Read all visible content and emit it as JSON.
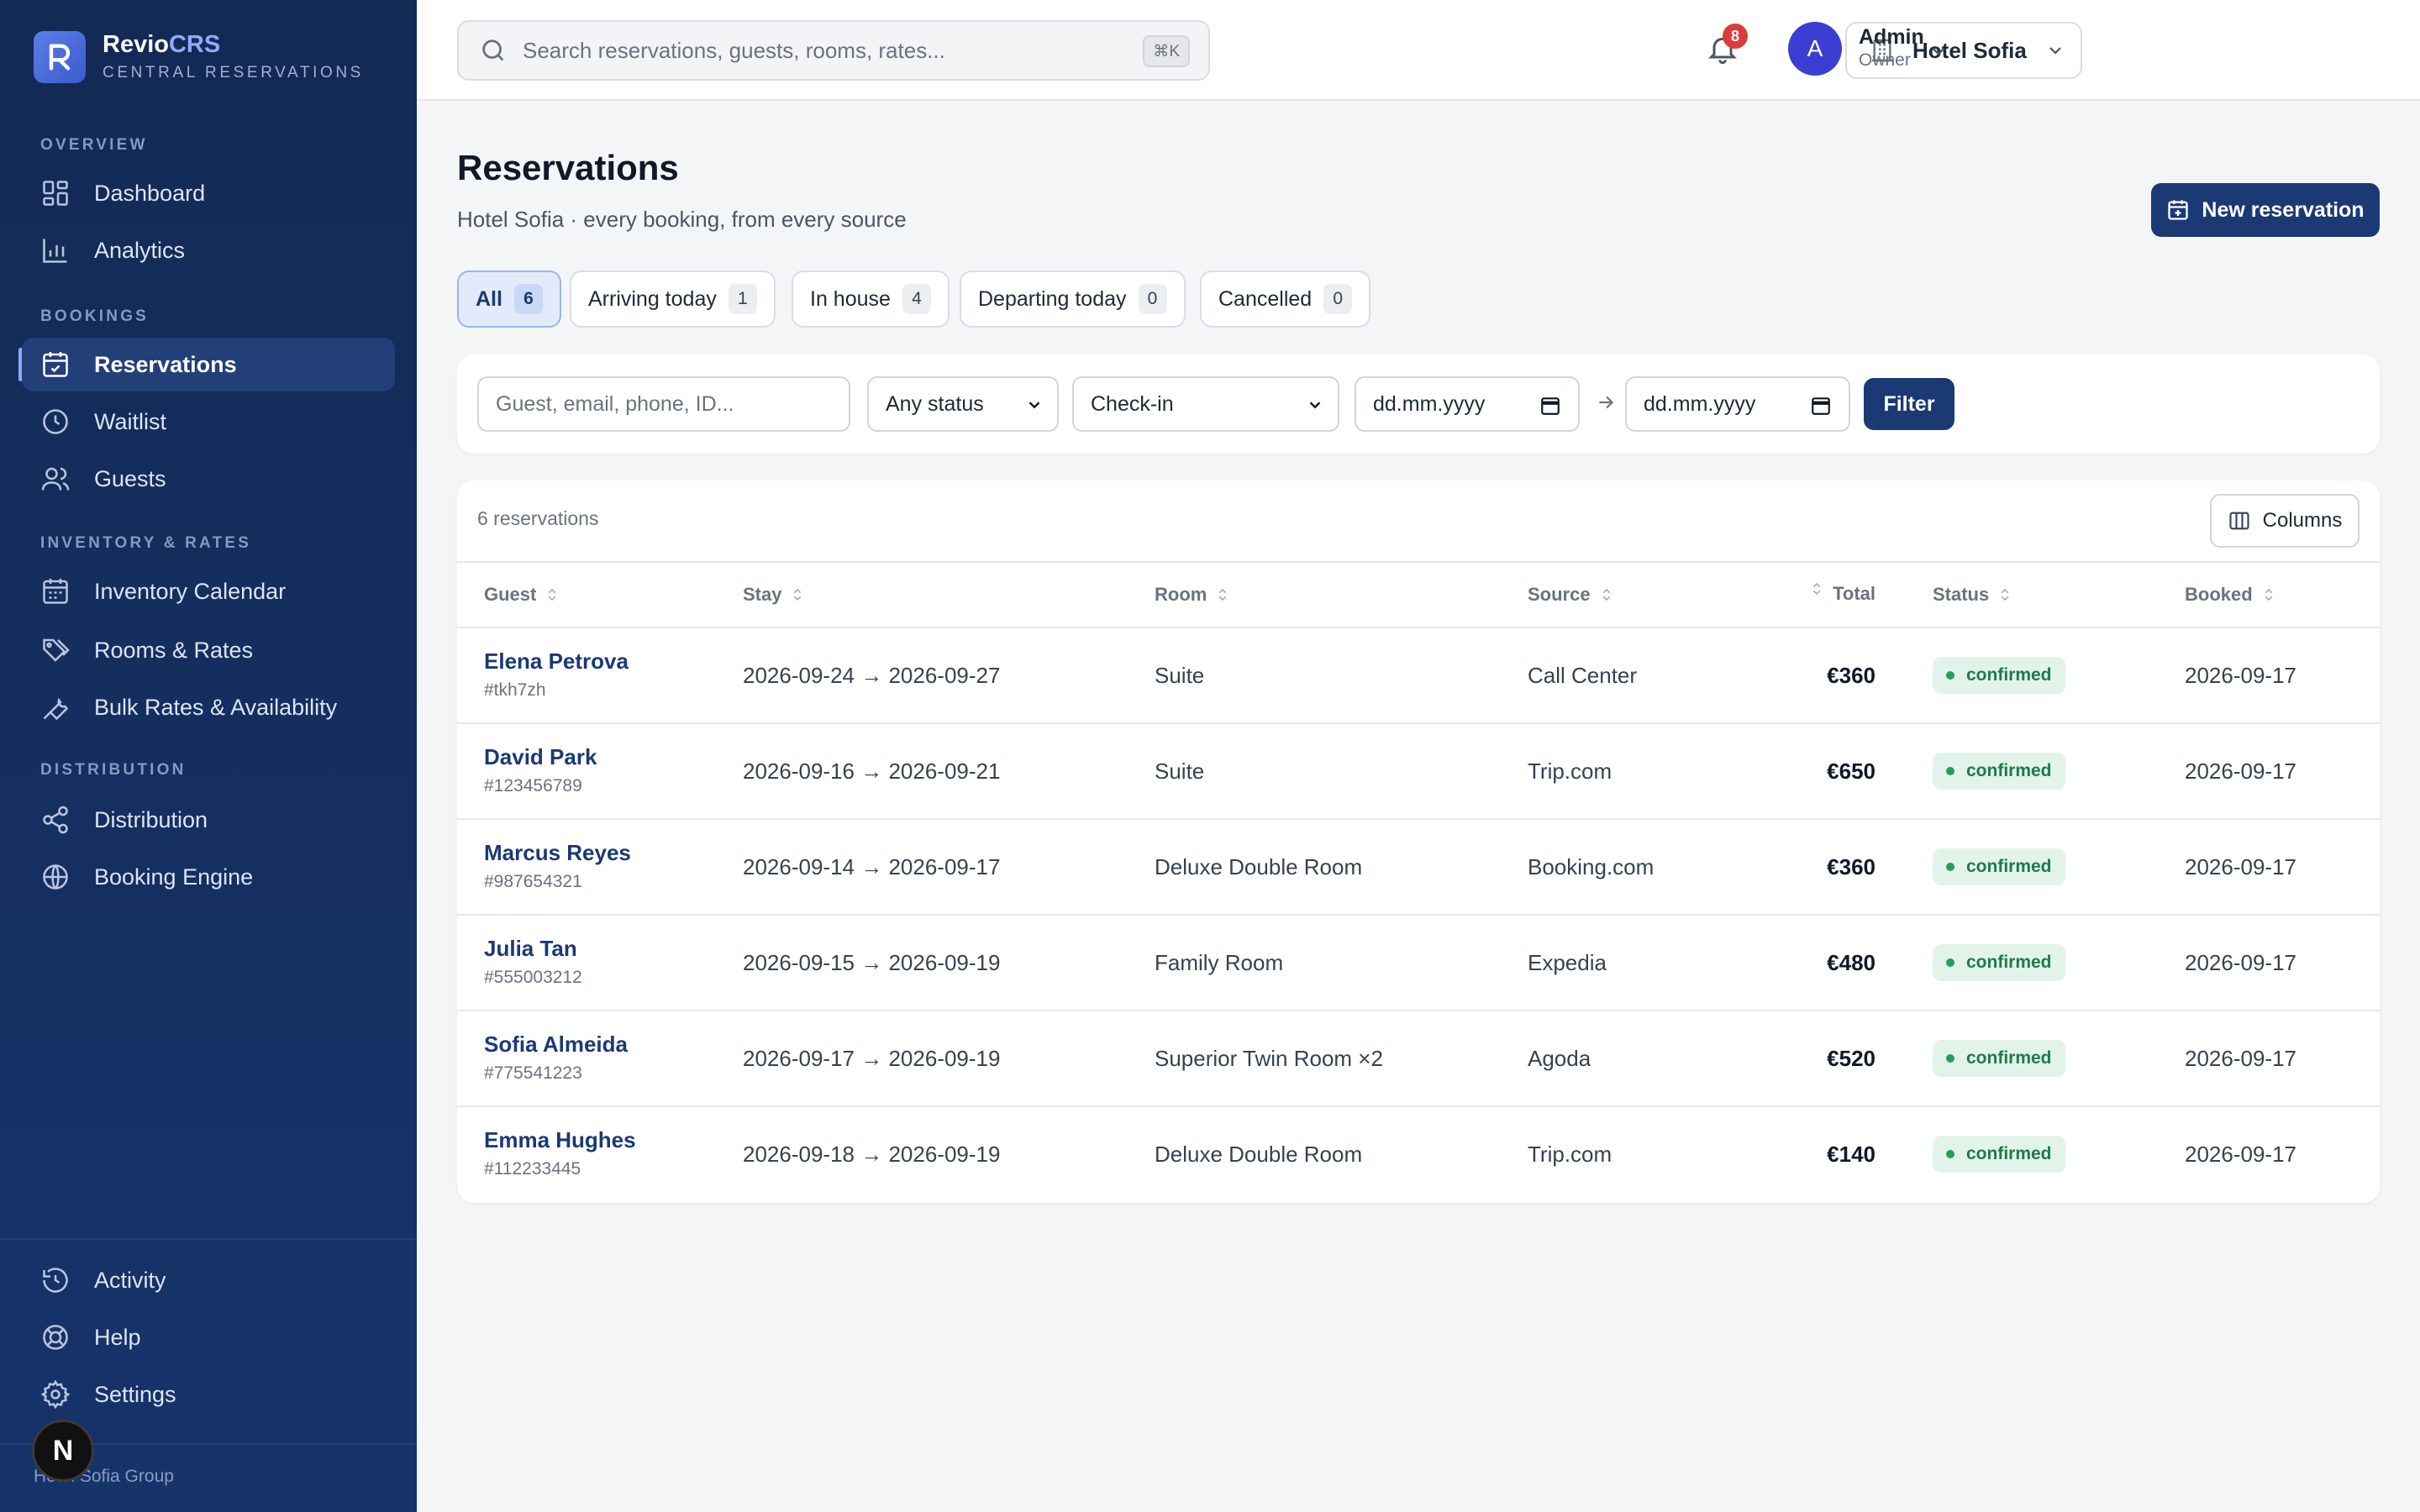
{
  "brand": {
    "name_main": "Revio",
    "name_accent": "CRS",
    "subtitle": "CENTRAL RESERVATIONS"
  },
  "sidebar": {
    "sections": [
      {
        "title": "OVERVIEW"
      },
      {
        "title": "BOOKINGS"
      },
      {
        "title": "INVENTORY & RATES"
      },
      {
        "title": "DISTRIBUTION"
      }
    ],
    "items": [
      {
        "label": "Dashboard",
        "icon": "dashboard-icon"
      },
      {
        "label": "Analytics",
        "icon": "analytics-icon"
      },
      {
        "label": "Reservations",
        "icon": "calendar-check-icon",
        "active": true
      },
      {
        "label": "Waitlist",
        "icon": "clock-icon"
      },
      {
        "label": "Guests",
        "icon": "users-icon"
      },
      {
        "label": "Inventory Calendar",
        "icon": "calendar-icon"
      },
      {
        "label": "Rooms & Rates",
        "icon": "tags-icon"
      },
      {
        "label": "Bulk Rates & Availability",
        "icon": "wrench-icon"
      },
      {
        "label": "Distribution",
        "icon": "share-icon"
      },
      {
        "label": "Booking Engine",
        "icon": "globe-icon"
      }
    ],
    "bottom_items": [
      {
        "label": "Activity",
        "icon": "history-icon"
      },
      {
        "label": "Help",
        "icon": "lifebuoy-icon"
      },
      {
        "label": "Settings",
        "icon": "gear-icon"
      }
    ],
    "footer": "Hotel Sofia Group",
    "badge_letter": "N"
  },
  "topbar": {
    "search_placeholder": "Search reservations, guests, rooms, rates...",
    "search_shortcut": "⌘K",
    "hotel": "Hotel Sofia",
    "notifications": "8",
    "user": {
      "initial": "A",
      "name": "Admin",
      "role": "Owner"
    }
  },
  "page": {
    "title": "Reservations",
    "subtitle": "Hotel Sofia · every booking, from every source",
    "new_button": "New reservation"
  },
  "tabs": [
    {
      "label": "All",
      "count": "6",
      "active": true
    },
    {
      "label": "Arriving today",
      "count": "1"
    },
    {
      "label": "In house",
      "count": "4"
    },
    {
      "label": "Departing today",
      "count": "0"
    },
    {
      "label": "Cancelled",
      "count": "0"
    }
  ],
  "filters": {
    "query_placeholder": "Guest, email, phone, ID...",
    "status_value": "Any status",
    "date_field_value": "Check-in",
    "date_from_placeholder": "dd.mm.yyyy",
    "date_to_placeholder": "dd.mm.yyyy",
    "filter_button": "Filter"
  },
  "table": {
    "count_label": "6 reservations",
    "columns_button": "Columns",
    "headers": {
      "guest": "Guest",
      "stay": "Stay",
      "room": "Room",
      "source": "Source",
      "total": "Total",
      "status": "Status",
      "booked": "Booked"
    },
    "rows": [
      {
        "name": "Elena Petrova",
        "id": "#tkh7zh",
        "stay": "2026-09-24 → 2026-09-27",
        "room": "Suite",
        "source": "Call Center",
        "total": "€360",
        "status": "confirmed",
        "booked": "2026-09-17"
      },
      {
        "name": "David Park",
        "id": "#123456789",
        "stay": "2026-09-16 → 2026-09-21",
        "room": "Suite",
        "source": "Trip.com",
        "total": "€650",
        "status": "confirmed",
        "booked": "2026-09-17"
      },
      {
        "name": "Marcus Reyes",
        "id": "#987654321",
        "stay": "2026-09-14 → 2026-09-17",
        "room": "Deluxe Double Room",
        "source": "Booking.com",
        "total": "€360",
        "status": "confirmed",
        "booked": "2026-09-17"
      },
      {
        "name": "Julia Tan",
        "id": "#555003212",
        "stay": "2026-09-15 → 2026-09-19",
        "room": "Family Room",
        "source": "Expedia",
        "total": "€480",
        "status": "confirmed",
        "booked": "2026-09-17"
      },
      {
        "name": "Sofia Almeida",
        "id": "#775541223",
        "stay": "2026-09-17 → 2026-09-19",
        "room": "Superior Twin Room ×2",
        "source": "Agoda",
        "total": "€520",
        "status": "confirmed",
        "booked": "2026-09-17"
      },
      {
        "name": "Emma Hughes",
        "id": "#112233445",
        "stay": "2026-09-18 → 2026-09-19",
        "room": "Deluxe Double Room",
        "source": "Trip.com",
        "total": "€140",
        "status": "confirmed",
        "booked": "2026-09-17"
      }
    ]
  },
  "colors": {
    "sidebar": "#132a55",
    "primary": "#1b3a73",
    "accent": "#8fa9ff",
    "status_confirmed": "#1f7a4a",
    "badge": "#dc3c3c"
  }
}
